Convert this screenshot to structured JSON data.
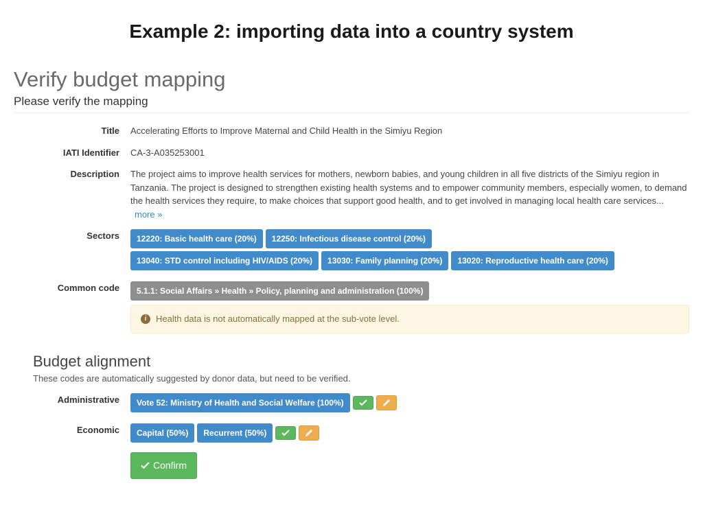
{
  "slide": {
    "title": "Example 2: importing data into a country system"
  },
  "page": {
    "heading": "Verify budget mapping",
    "subheading": "Please verify the mapping"
  },
  "fields": {
    "title_label": "Title",
    "title_value": "Accelerating Efforts to Improve Maternal and Child Health in the Simiyu Region",
    "iati_label": "IATI Identifier",
    "iati_value": "CA-3-A035253001",
    "description_label": "Description",
    "description_value": "The project aims to improve health services for mothers, newborn babies, and young children in all five districts of the Simiyu region in Tanzania. The project is designed to strengthen existing health systems and to empower community members, especially women, to demand the health services they require, to make choices that support good health, and to get involved in managing local health care services...",
    "more_label": "more »",
    "sectors_label": "Sectors",
    "sectors": [
      "12220: Basic health care (20%)",
      "12250: Infectious disease control (20%)",
      "13040: STD control including HIV/AIDS (20%)",
      "13030: Family planning (20%)",
      "13020: Reproductive health care (20%)"
    ],
    "common_code_label": "Common code",
    "common_code_value": "5.1.1: Social Affairs » Health » Policy, planning and administration (100%)",
    "warning_text": "Health data is not automatically mapped at the sub-vote level."
  },
  "budget": {
    "heading": "Budget alignment",
    "subheading": "These codes are automatically suggested by donor data, but need to be verified.",
    "admin_label": "Administrative",
    "admin_value": "Vote 52: Ministry of Health and Social Welfare (100%)",
    "economic_label": "Economic",
    "economic_values": [
      "Capital (50%)",
      "Recurrent (50%)"
    ],
    "confirm_label": "Confirm"
  }
}
